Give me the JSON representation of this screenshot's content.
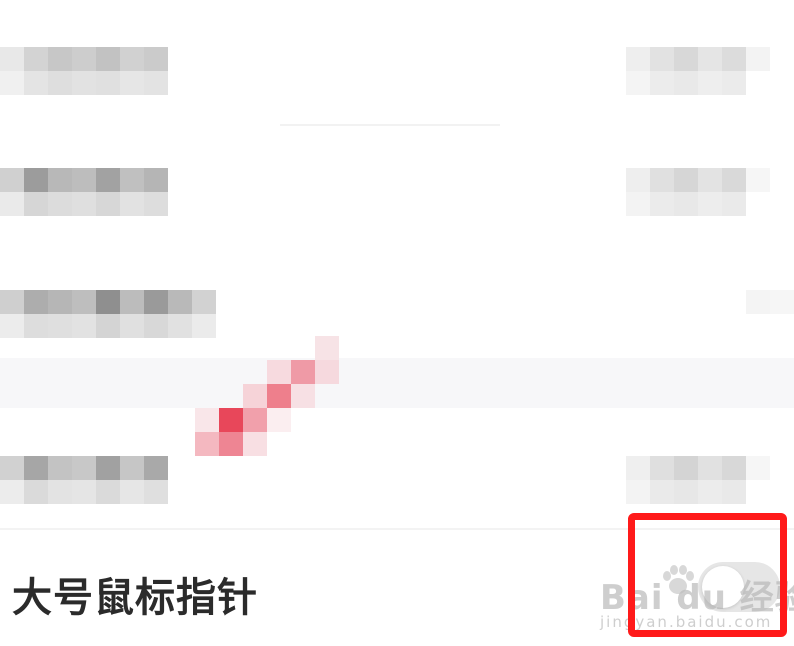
{
  "setting": {
    "label": "大号鼠标指针",
    "toggle": {
      "state": "off"
    }
  },
  "watermark": {
    "brand": "Bai du 经验",
    "url": "jingyan.baidu.com"
  },
  "colors": {
    "highlight_border": "#ff1a1a",
    "toggle_off_track": "#e6e6e6"
  },
  "icons": {
    "watermark_logo": "paw-print-icon"
  }
}
